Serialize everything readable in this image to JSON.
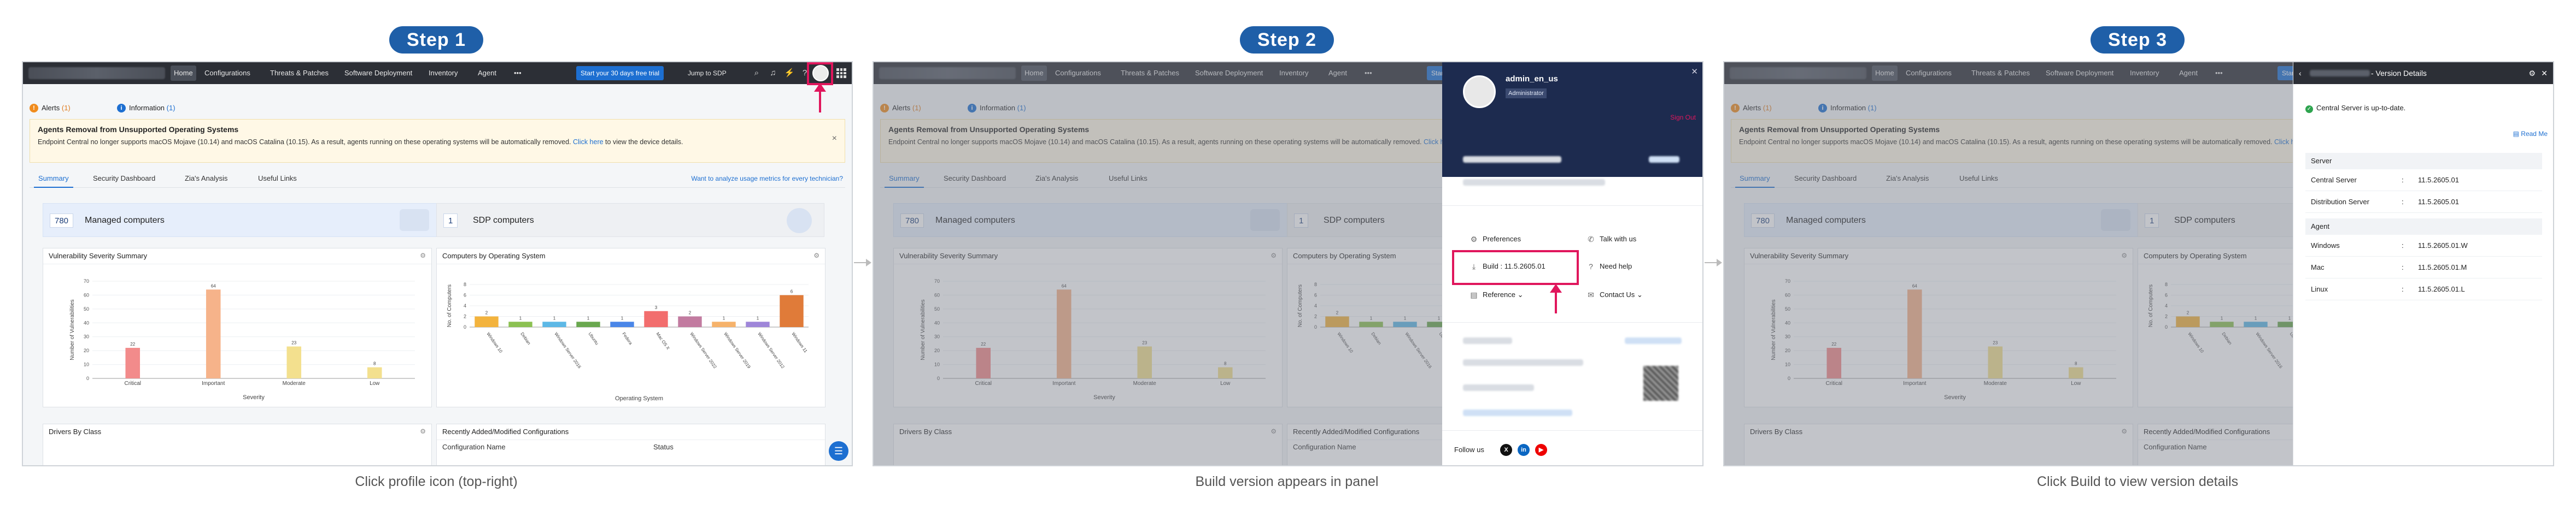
{
  "steps": [
    {
      "badge": "Step 1",
      "caption": "Click profile icon (top-right)"
    },
    {
      "badge": "Step 2",
      "caption": "Build version appears in panel"
    },
    {
      "badge": "Step 3",
      "caption": "Click Build to view version details"
    }
  ],
  "nav": {
    "items": [
      "Home",
      "Configurations",
      "Threats & Patches",
      "Software Deployment",
      "Inventory",
      "Agent",
      "•••"
    ],
    "trial_button": "Start your 30 days free trial",
    "jump_label": "Jump to SDP"
  },
  "alerts": {
    "alerts_tab": "Alerts",
    "alerts_count": "(1)",
    "info_tab": "Information",
    "info_count": "(1)",
    "title": "Agents Removal from Unsupported Operating Systems",
    "text": "Endpoint Central no longer supports macOS Mojave (10.14) and macOS Catalina (10.15). As a result, agents running on these operating systems will be automatically removed.",
    "link": "Click here",
    "text_after": " to view the device details.",
    "close": "×"
  },
  "subtabs": [
    "Summary",
    "Security Dashboard",
    "Zia's Analysis",
    "Useful Links"
  ],
  "usage_link": "Want to analyze usage metrics for every technician?",
  "stats": {
    "managed_count": "780",
    "managed_label": "Managed computers",
    "sdp_count": "1",
    "sdp_label": "SDP computers"
  },
  "panels": {
    "vuln_title": "Vulnerability Severity Summary",
    "os_title": "Computers by Operating System",
    "drivers_title": "Drivers By Class",
    "recent_title": "Recently Added/Modified Configurations",
    "config_col": "Configuration Name",
    "status_col": "Status"
  },
  "chart_data": [
    {
      "type": "bar",
      "title": "Vulnerability Severity Summary",
      "xlabel": "Severity",
      "ylabel": "Number of Vulnerabilities",
      "categories": [
        "Critical",
        "Important",
        "Moderate",
        "Low"
      ],
      "values": [
        22,
        64,
        23,
        8
      ],
      "colors": [
        "#f28b8b",
        "#f6b38a",
        "#f3e08e",
        "#f3e08e"
      ],
      "ylim": [
        0,
        70
      ],
      "yticks": [
        0,
        10,
        20,
        30,
        40,
        50,
        60,
        70
      ]
    },
    {
      "type": "bar",
      "title": "Computers by Operating System",
      "xlabel": "Operating System",
      "ylabel": "No. of Computers",
      "categories": [
        "Windows 10",
        "Debian",
        "Windows Server 2016",
        "Ubuntu",
        "Fedora",
        "Mac OS X",
        "Windows Server 2022",
        "Windows Server 2019",
        "Windows Server 2012",
        "Windows 11"
      ],
      "values": [
        2,
        1,
        1,
        1,
        1,
        3,
        2,
        1,
        1,
        6
      ],
      "colors": [
        "#f3b33d",
        "#8cc152",
        "#5db8e6",
        "#6aa84f",
        "#4a86e8",
        "#f26d6d",
        "#c27ba0",
        "#f6b26b",
        "#9f86d9",
        "#e07b39"
      ],
      "ylim": [
        0,
        8
      ],
      "yticks": [
        0,
        2,
        4,
        6,
        8
      ]
    }
  ],
  "profile": {
    "name": "admin_en_us",
    "role": "Administrator",
    "signout": "Sign Out",
    "preferences": "Preferences",
    "talk": "Talk with us",
    "build": "Build : 11.5.2605.01",
    "need_help": "Need help",
    "reference": "Reference",
    "contact": "Contact Us",
    "follow": "Follow us"
  },
  "version": {
    "title": "- Version Details",
    "status": "Central Server is up-to-date.",
    "readme": "Read Me",
    "server_group": "Server",
    "server_rows": [
      {
        "key": "Central Server",
        "sep": ":",
        "value": "11.5.2605.01"
      },
      {
        "key": "Distribution Server",
        "sep": ":",
        "value": "11.5.2605.01"
      }
    ],
    "agent_group": "Agent",
    "agent_rows": [
      {
        "key": "Windows",
        "sep": ":",
        "value": "11.5.2605.01.W"
      },
      {
        "key": "Mac",
        "sep": ":",
        "value": "11.5.2605.01.M"
      },
      {
        "key": "Linux",
        "sep": ":",
        "value": "11.5.2605.01.L"
      }
    ]
  },
  "colors": {
    "badge": "#1f5fa8",
    "highlight": "#e0165c",
    "nav": "#2c2f36",
    "accent": "#1d6fd1",
    "profile_header": "#1d2b4f"
  }
}
